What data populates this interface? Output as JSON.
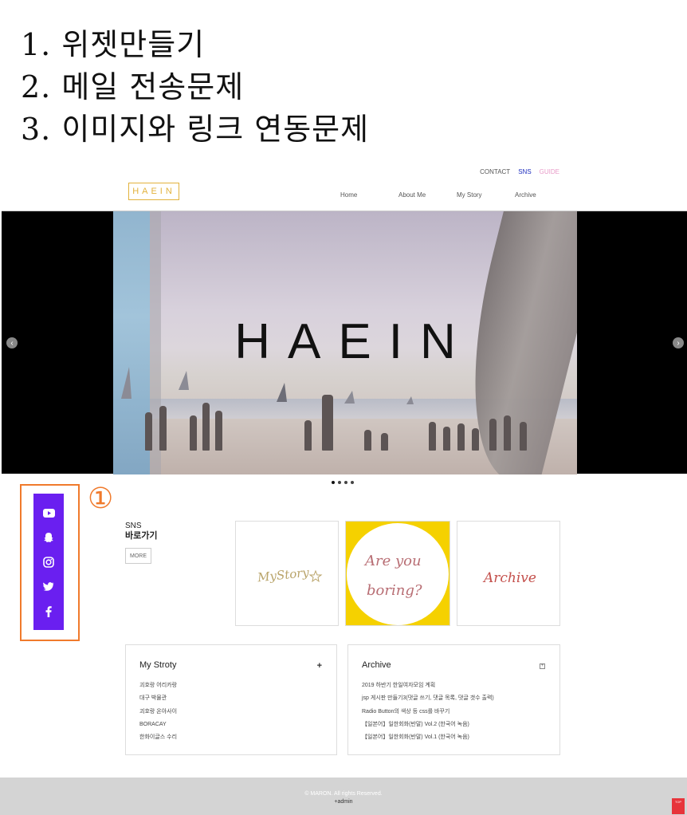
{
  "notes": [
    "1. 위젯만들기",
    "2. 메일 전송문제",
    "3. 이미지와 링크 연동문제"
  ],
  "header": {
    "top_links": {
      "contact": "CONTACT",
      "sns": "SNS",
      "guide": "GUIDE"
    },
    "logo": "HAEIN",
    "nav": [
      "Home",
      "About Me",
      "My Story",
      "Archive"
    ]
  },
  "hero": {
    "title": "HAEIN",
    "prev_icon": "chevron-left-icon",
    "next_icon": "chevron-right-icon",
    "slides_total": 4,
    "active_slide": 1
  },
  "widget": {
    "annotation": "①",
    "icons": [
      "youtube-icon",
      "snapchat-icon",
      "instagram-icon",
      "twitter-icon",
      "facebook-icon"
    ],
    "frame_color": "#f07a2c",
    "bar_color": "#6a1ff0"
  },
  "sns": {
    "title": "SNS",
    "subtitle": "바로가기",
    "more": "MORE"
  },
  "cards": [
    {
      "text": "MyStory"
    },
    {
      "text_line1": "Are you",
      "text_line2": "boring?"
    },
    {
      "text": "Archive"
    }
  ],
  "my_story": {
    "title": "My Stroty",
    "items": [
      "괴호랑 어리카랑",
      "대구 박물관",
      "괴호랑 온아사이",
      "BORACAY",
      "한화이글스 수리"
    ]
  },
  "archive": {
    "title": "Archive",
    "items": [
      "2019 하반기 한일여자모임 계획",
      "jsp 게시판 만들기3(댓글 쓰기, 댓글 목록, 댓글 갯수 출력)",
      "Radio Button의 색상 등 css를 바꾸기",
      "【일본어】일한회화(반말) Vol.2 (한국어 녹음)",
      "【일본어】일한회화(반말) Vol.1 (한국어 녹음)"
    ]
  },
  "footer": {
    "copyright": "© MARON. All rights Reserved.",
    "admin": "+admin",
    "top_button": "TOP"
  }
}
